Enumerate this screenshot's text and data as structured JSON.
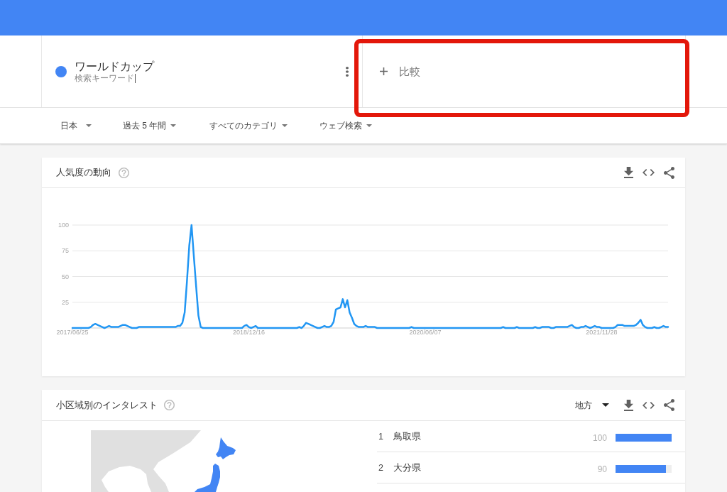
{
  "search_terms": [
    {
      "term": "ワールドカップ",
      "subtitle": "検索キーワード",
      "color": "#4285f4"
    }
  ],
  "compare": {
    "label": "比較"
  },
  "filters": [
    {
      "label": "日本"
    },
    {
      "label": "過去 5 年間"
    },
    {
      "label": "すべてのカテゴリ"
    },
    {
      "label": "ウェブ検索"
    }
  ],
  "interest_over_time": {
    "title": "人気度の動向",
    "chart_data": {
      "type": "line",
      "grid": true,
      "categories": [
        "2017/06/25",
        null,
        null,
        null,
        null,
        null,
        null,
        null,
        null,
        null,
        null,
        null,
        null,
        null,
        null,
        null,
        null,
        null,
        null,
        null,
        null,
        null,
        null,
        null,
        null,
        null,
        null,
        null,
        null,
        null,
        null,
        null,
        null,
        null,
        null,
        null,
        null,
        null,
        null,
        null,
        null,
        null,
        null,
        null,
        null,
        null,
        null,
        null,
        null,
        null,
        null,
        null,
        null,
        null,
        null,
        null,
        null,
        null,
        null,
        null,
        null,
        null,
        null,
        null,
        null,
        null,
        null,
        null,
        null,
        null,
        null,
        null,
        null,
        null,
        null,
        null,
        null,
        "2018/12/16",
        null,
        null,
        null,
        null,
        null,
        null,
        null,
        null,
        null,
        null,
        null,
        null,
        null,
        null,
        null,
        null,
        null,
        null,
        null,
        null,
        null,
        null,
        null,
        null,
        null,
        null,
        null,
        null,
        null,
        null,
        null,
        null,
        null,
        null,
        null,
        null,
        null,
        null,
        null,
        null,
        null,
        null,
        null,
        null,
        null,
        null,
        null,
        null,
        null,
        null,
        null,
        null,
        null,
        null,
        null,
        null,
        null,
        null,
        null,
        null,
        null,
        null,
        null,
        null,
        null,
        null,
        null,
        null,
        null,
        null,
        null,
        null,
        null,
        null,
        null,
        null,
        "2020/06/07",
        null,
        null,
        null,
        null,
        null,
        null,
        null,
        null,
        null,
        null,
        null,
        null,
        null,
        null,
        null,
        null,
        null,
        null,
        null,
        null,
        null,
        null,
        null,
        null,
        null,
        null,
        null,
        null,
        null,
        null,
        null,
        null,
        null,
        null,
        null,
        null,
        null,
        null,
        null,
        null,
        null,
        null,
        null,
        null,
        null,
        null,
        null,
        null,
        null,
        null,
        null,
        null,
        null,
        null,
        null,
        null,
        null,
        null,
        null,
        null,
        null,
        null,
        null,
        null,
        null,
        null,
        null,
        null,
        null,
        null,
        null,
        null,
        null,
        null,
        null,
        null,
        "2021/11/28",
        null,
        null,
        null,
        null,
        null,
        null,
        null,
        null,
        null,
        null,
        null,
        null,
        null,
        null,
        null,
        null,
        null,
        null,
        null,
        null,
        null,
        null,
        null,
        null,
        null,
        null,
        null,
        null,
        null
      ],
      "series": [
        {
          "color": "#2196f3",
          "values": [
            0,
            0,
            0,
            0,
            0,
            0,
            0,
            0,
            1,
            3,
            4,
            3,
            2,
            1,
            0,
            1,
            2,
            1,
            1,
            1,
            1,
            2,
            3,
            3,
            2,
            1,
            0,
            0,
            0,
            1,
            1,
            1,
            1,
            1,
            1,
            1,
            1,
            1,
            1,
            1,
            1,
            1,
            1,
            1,
            1,
            1,
            2,
            2,
            5,
            15,
            45,
            80,
            100,
            70,
            40,
            12,
            1,
            0,
            0,
            0,
            0,
            0,
            0,
            0,
            0,
            0,
            0,
            0,
            0,
            0,
            0,
            0,
            0,
            0,
            0,
            2,
            3,
            1,
            0,
            1,
            2,
            0,
            0,
            0,
            0,
            0,
            0,
            0,
            0,
            0,
            0,
            0,
            0,
            0,
            0,
            0,
            0,
            0,
            0,
            1,
            0,
            2,
            5,
            4,
            3,
            2,
            1,
            0,
            0,
            1,
            2,
            1,
            1,
            2,
            6,
            18,
            19,
            20,
            28,
            20,
            27,
            15,
            10,
            4,
            2,
            1,
            1,
            1,
            2,
            1,
            1,
            1,
            1,
            0,
            0,
            0,
            0,
            0,
            0,
            0,
            0,
            0,
            0,
            0,
            0,
            0,
            0,
            0,
            1,
            0,
            0,
            0,
            0,
            0,
            0,
            0,
            0,
            0,
            0,
            0,
            0,
            0,
            0,
            0,
            0,
            0,
            0,
            0,
            0,
            0,
            0,
            0,
            0,
            0,
            0,
            0,
            0,
            0,
            0,
            0,
            0,
            0,
            0,
            0,
            0,
            0,
            0,
            0,
            1,
            0,
            0,
            0,
            0,
            0,
            1,
            0,
            0,
            0,
            0,
            0,
            0,
            0,
            1,
            0,
            0,
            1,
            1,
            1,
            1,
            0,
            0,
            1,
            1,
            1,
            1,
            1,
            1,
            2,
            3,
            1,
            0,
            0,
            1,
            1,
            2,
            1,
            0,
            1,
            2,
            1,
            1,
            0,
            0,
            0,
            0,
            0,
            0,
            1,
            3,
            3,
            3,
            2,
            2,
            2,
            2,
            2,
            3,
            5,
            8,
            3,
            1,
            0,
            0,
            0,
            1,
            0,
            0,
            1,
            2,
            1,
            1
          ]
        }
      ],
      "ylim": [
        0,
        100
      ],
      "yticks": [
        25,
        50,
        75,
        100
      ]
    }
  },
  "interest_by_subregion": {
    "title": "小区域別のインタレスト",
    "resolution": "地方",
    "regions": [
      {
        "rank": "1",
        "name": "鳥取県",
        "value": "100",
        "level": 1
      },
      {
        "rank": "2",
        "name": "大分県",
        "value": "90",
        "level": 0.9
      }
    ]
  }
}
